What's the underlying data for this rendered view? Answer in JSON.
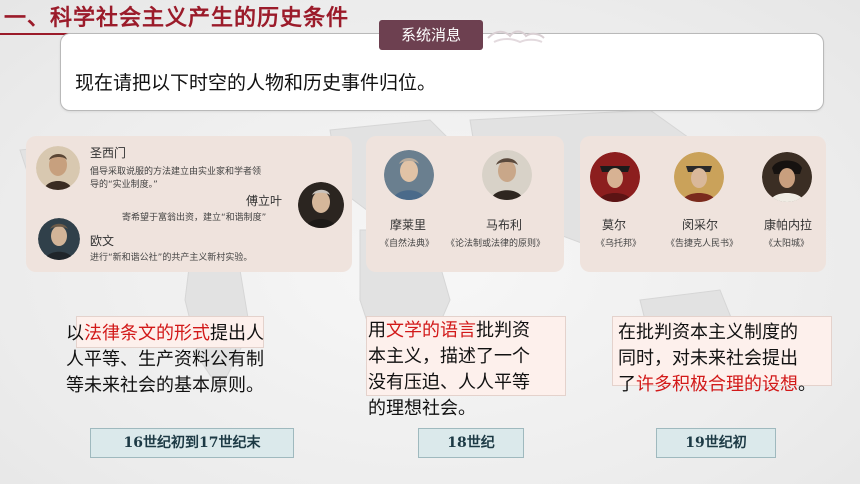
{
  "section_title": "一、科学社会主义产生的历史条件",
  "message": {
    "tag": "系统消息",
    "text": "现在请把以下时空的人物和历史事件归位。"
  },
  "cards": {
    "card1": {
      "saint_simon": {
        "name": "圣西门",
        "desc_line1": "倡导采取说服的方法建立由实业家和学者领",
        "desc_line2": "导的“实业制度。”"
      },
      "fourier": {
        "name": "傅立叶",
        "desc": "寄希望于富翁出资，建立“和谐制度”"
      },
      "owen": {
        "name": "欧文",
        "desc": "进行“新和谐公社”的共产主义新村实验。"
      }
    },
    "card2": {
      "morelly": {
        "name": "摩莱里",
        "book": "《自然法典》"
      },
      "mably": {
        "name": "马布利",
        "book": "《论法制或法律的原则》"
      }
    },
    "card3": {
      "more": {
        "name": "莫尔",
        "book": "《乌托邦》"
      },
      "muenzer": {
        "name": "闵采尔",
        "book": "《告捷克人民书》"
      },
      "campanella": {
        "name": "康帕内拉",
        "book": "《太阳城》"
      }
    }
  },
  "descriptions": {
    "d1": {
      "pre": "以",
      "hl": "法律条文的形式",
      "post1": "提出人",
      "line2": "人平等、生产资料公有制",
      "line3": "等未来社会的基本原则。"
    },
    "d2": {
      "pre": "用",
      "hl": "文学的语言",
      "post1": "批判资",
      "line2": "本主义，描述了一个",
      "line3": "没有压迫、人人平等",
      "line4": "的理想社会。"
    },
    "d3": {
      "line1": "在批判资本主义制度的",
      "line2": "同时，对未来社会提出",
      "pre3": "了",
      "hl": "许多积极合理的设想",
      "post3": "。"
    }
  },
  "eras": {
    "e1": "16世纪初到17世纪末",
    "e2": "18世纪",
    "e3": "19世纪初"
  },
  "colors": {
    "title": "#9b1b2a",
    "highlight": "#d21919",
    "card_bg": "#efe3dd",
    "era_bg": "#dbe9eb",
    "tag_bg": "#6d4050"
  }
}
